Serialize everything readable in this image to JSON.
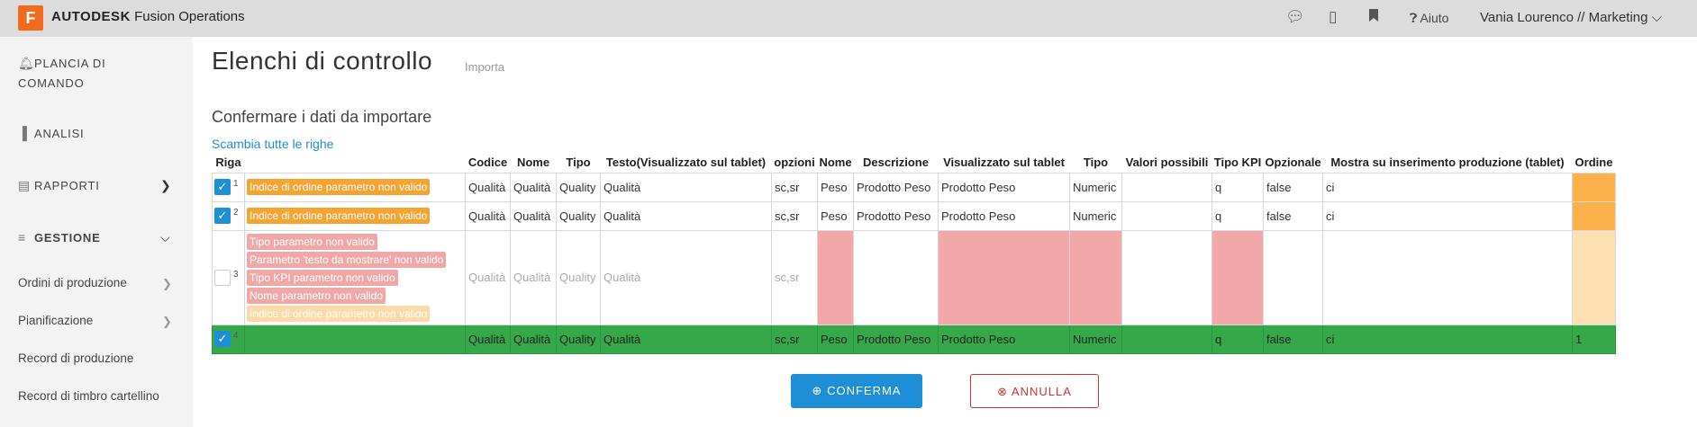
{
  "app": {
    "logo_letter": "F",
    "brand_bold": "AUTODESK",
    "brand_rest": "Fusion Operations"
  },
  "topbar": {
    "help": "Aiuto",
    "user": "Vania Lourenco // Marketing"
  },
  "sidebar": {
    "dashboard": "PLANCIA DI COMANDO",
    "analysis": "ANALISI",
    "reports": "RAPPORTI",
    "management": "GESTIONE",
    "sub": [
      "Ordini di produzione",
      "Pianificazione",
      "Record di produzione",
      "Record di timbro cartellino"
    ]
  },
  "page": {
    "title": "Elenchi di controllo",
    "subtitle": "Importa",
    "confirm_heading": "Confermare i dati da importare",
    "swap_link": "Scambia tutte le righe"
  },
  "table": {
    "headers": [
      "Riga",
      "",
      "Codice",
      "Nome",
      "Tipo",
      "Testo(Visualizzato sul tablet)",
      "opzioni",
      "Nome",
      "Descrizione",
      "Visualizzato sul tablet",
      "Tipo",
      "Valori possibili",
      "Tipo KPI",
      "Opzionale",
      "Mostra su inserimento produzione (tablet)",
      "Ordine"
    ],
    "rows": [
      {
        "num": "1",
        "errors": [
          "Indice di ordine parametro non valido"
        ],
        "cells": [
          "Qualità",
          "Qualità",
          "Quality",
          "Qualità",
          "sc,sr",
          "Peso",
          "Prodotto Peso",
          "Prodotto Peso",
          "Numeric",
          "",
          "q",
          "false",
          "ci",
          ""
        ]
      },
      {
        "num": "2",
        "errors": [
          "Indice di ordine parametro non valido"
        ],
        "cells": [
          "Qualità",
          "Qualità",
          "Quality",
          "Qualità",
          "sc,sr",
          "Peso",
          "Prodotto Peso",
          "Prodotto Peso",
          "Numeric",
          "",
          "q",
          "false",
          "ci",
          ""
        ]
      },
      {
        "num": "3",
        "errors": [
          "Tipo parametro non valido",
          "Parametro 'testo da mostrare' non valido",
          "Tipo KPI parametro non valido",
          "Nome parametro non valido",
          "Indice di ordine parametro non valido"
        ],
        "cells": [
          "Qualità",
          "Qualità",
          "Quality",
          "Qualità",
          "sc,sr",
          "",
          "",
          "",
          "",
          "",
          "",
          "",
          "",
          ""
        ]
      },
      {
        "num": "4",
        "errors": [],
        "cells": [
          "Qualità",
          "Qualità",
          "Quality",
          "Qualità",
          "sc,sr",
          "Peso",
          "Prodotto Peso",
          "Prodotto Peso",
          "Numeric",
          "",
          "q",
          "false",
          "ci",
          "1"
        ]
      }
    ]
  },
  "buttons": {
    "confirm": "CONFERMA",
    "cancel": "ANNULLA"
  }
}
